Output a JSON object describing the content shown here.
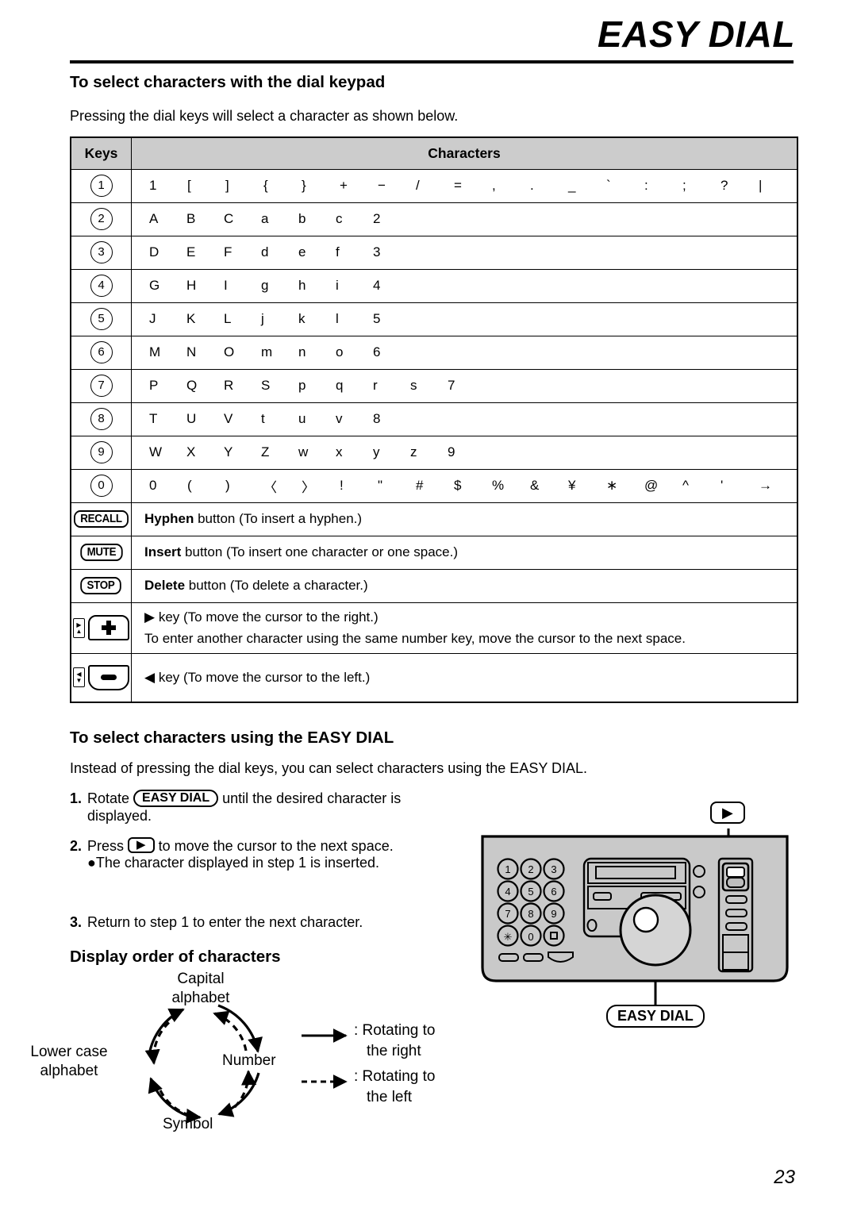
{
  "header": {
    "title": "EASY DIAL"
  },
  "section1": {
    "heading": "To select characters with the dial keypad",
    "intro": "Pressing the dial keys will select a character as shown below.",
    "table": {
      "columns": [
        "Keys",
        "Characters"
      ],
      "rows": [
        {
          "key": "1",
          "key_type": "circle",
          "chars": [
            "1",
            "[",
            "]",
            "{",
            "}",
            "+",
            "−",
            "/",
            "=",
            ",",
            ".",
            "_",
            "`",
            ":",
            ";",
            "?",
            "|"
          ]
        },
        {
          "key": "2",
          "key_type": "circle",
          "chars": [
            "A",
            "B",
            "C",
            "a",
            "b",
            "c",
            "2"
          ]
        },
        {
          "key": "3",
          "key_type": "circle",
          "chars": [
            "D",
            "E",
            "F",
            "d",
            "e",
            "f",
            "3"
          ]
        },
        {
          "key": "4",
          "key_type": "circle",
          "chars": [
            "G",
            "H",
            "I",
            "g",
            "h",
            "i",
            "4"
          ]
        },
        {
          "key": "5",
          "key_type": "circle",
          "chars": [
            "J",
            "K",
            "L",
            "j",
            "k",
            "l",
            "5"
          ]
        },
        {
          "key": "6",
          "key_type": "circle",
          "chars": [
            "M",
            "N",
            "O",
            "m",
            "n",
            "o",
            "6"
          ]
        },
        {
          "key": "7",
          "key_type": "circle",
          "chars": [
            "P",
            "Q",
            "R",
            "S",
            "p",
            "q",
            "r",
            "s",
            "7"
          ]
        },
        {
          "key": "8",
          "key_type": "circle",
          "chars": [
            "T",
            "U",
            "V",
            "t",
            "u",
            "v",
            "8"
          ]
        },
        {
          "key": "9",
          "key_type": "circle",
          "chars": [
            "W",
            "X",
            "Y",
            "Z",
            "w",
            "x",
            "y",
            "z",
            "9"
          ]
        },
        {
          "key": "0",
          "key_type": "circle",
          "chars": [
            "0",
            "(",
            ")",
            "〈",
            "〉",
            "!",
            "\"",
            "#",
            "$",
            "%",
            "&",
            "¥",
            "∗",
            "@",
            "^",
            "'",
            "→"
          ]
        }
      ],
      "button_rows": [
        {
          "key_label": "RECALL",
          "bold": "Hyphen",
          "rest": " button (To insert a hyphen.)"
        },
        {
          "key_label": "MUTE",
          "bold": "Insert",
          "rest": " button (To insert one character or one space.)"
        },
        {
          "key_label": "STOP",
          "bold": "Delete",
          "rest": " button (To delete a character.)"
        }
      ],
      "nav_rows": [
        {
          "icon": "nav-up-plus-key",
          "line1": "▶ key (To move the cursor to the right.)",
          "line2": "To enter another character using the same number key, move the cursor to the next space."
        },
        {
          "icon": "nav-down-minus-key",
          "line1": "◀ key (To move the cursor to the left.)",
          "line2": ""
        }
      ]
    }
  },
  "section2": {
    "heading": "To select characters using the EASY DIAL",
    "intro": "Instead of pressing the dial keys, you can select characters using the EASY DIAL.",
    "steps": [
      {
        "num": "1.",
        "pre": "Rotate ",
        "button": "EASY DIAL",
        "post": " until the desired character is",
        "cont": "displayed.",
        "bullet": ""
      },
      {
        "num": "2.",
        "pre": "Press ",
        "button": "▶",
        "post": " to move the cursor to the next space.",
        "cont": "",
        "bullet": "The character displayed in step 1 is inserted."
      },
      {
        "num": "3.",
        "pre": "Return to step 1 to enter the next character.",
        "button": "",
        "post": "",
        "cont": "",
        "bullet": ""
      }
    ]
  },
  "section3": {
    "heading": "Display order of characters",
    "cycle": {
      "nodes": [
        {
          "id": "capital",
          "label_line1": "Capital",
          "label_line2": "alphabet"
        },
        {
          "id": "number",
          "label_line1": "Number",
          "label_line2": ""
        },
        {
          "id": "symbol",
          "label_line1": "Symbol",
          "label_line2": ""
        },
        {
          "id": "lowercase",
          "label_line1": "Lower case",
          "label_line2": "alphabet"
        }
      ]
    },
    "legend": [
      {
        "style": "solid",
        "text_line1": ": Rotating to",
        "text_line2": "the right"
      },
      {
        "style": "dashed",
        "text_line1": ": Rotating to",
        "text_line2": "the left"
      }
    ]
  },
  "device": {
    "callout_right_button": "▶",
    "callout_dial": "EASY DIAL",
    "keypad": [
      "1",
      "2",
      "3",
      "4",
      "5",
      "6",
      "7",
      "8",
      "9",
      "✱",
      "0",
      "□"
    ],
    "body_color": "#c9c9c9"
  },
  "footer": {
    "page_number": "23"
  }
}
